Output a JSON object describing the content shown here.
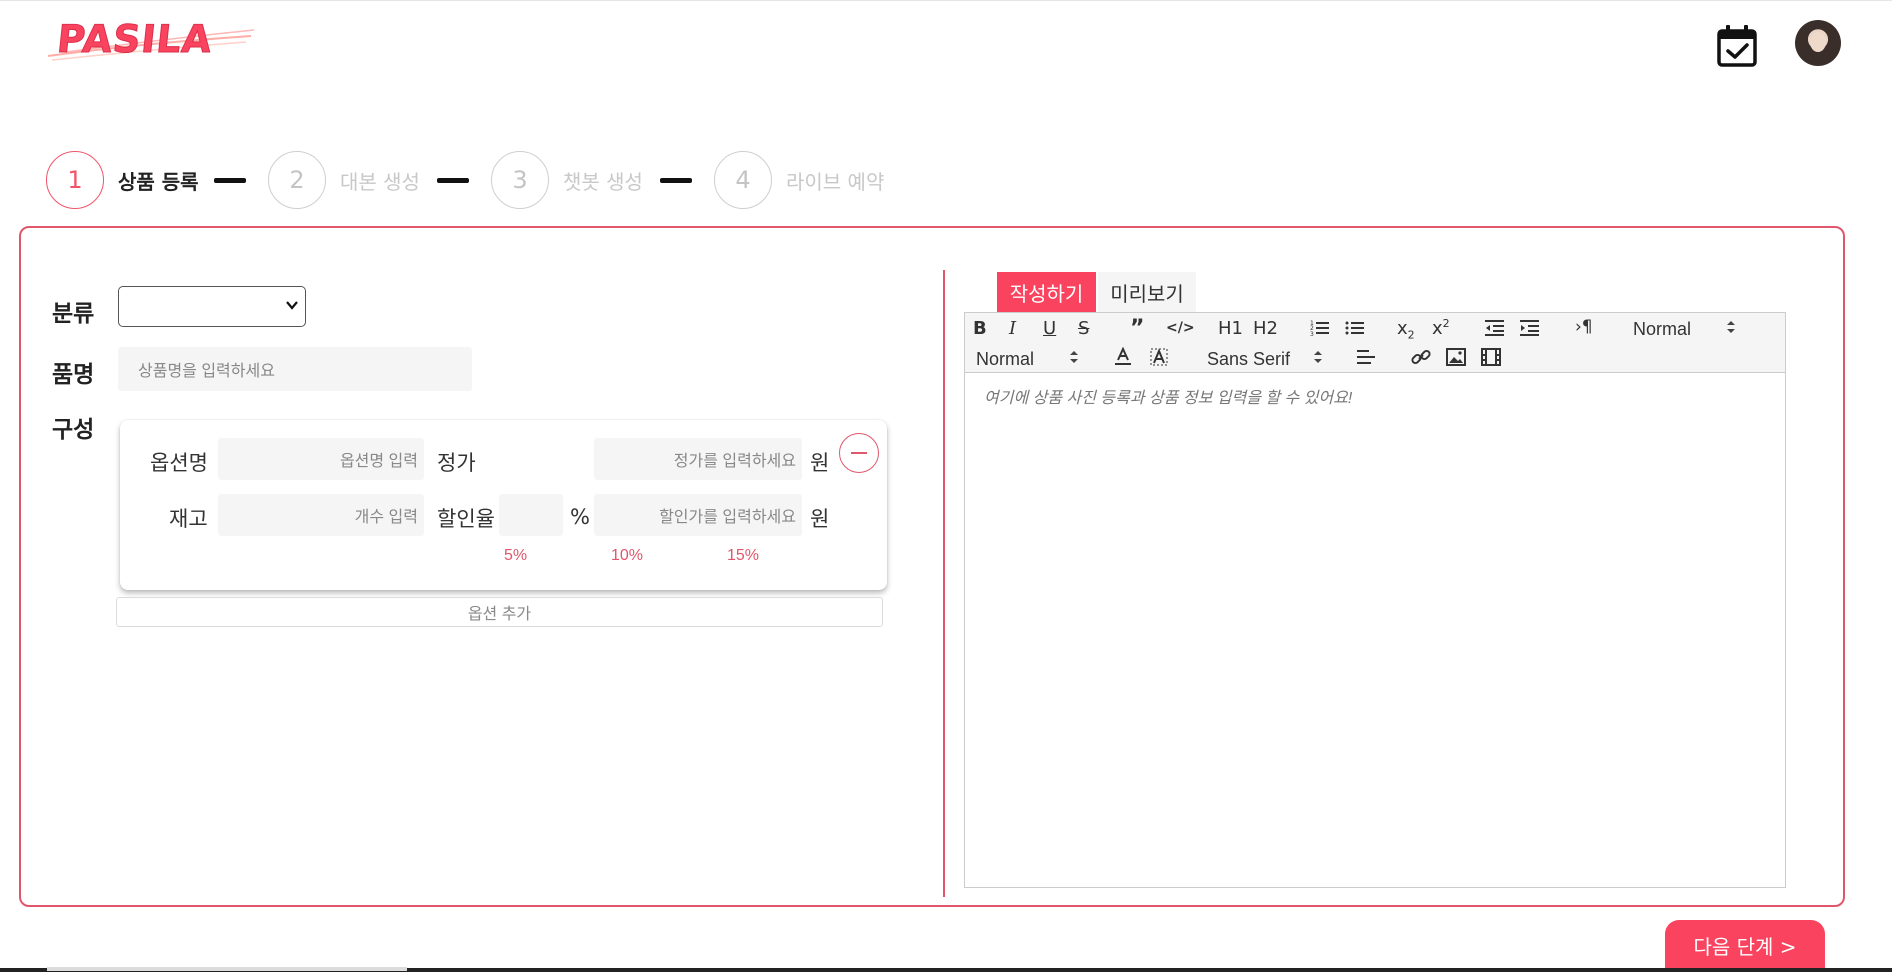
{
  "header": {
    "logo_text": "PASILA",
    "calendar_icon": "calendar-check-icon",
    "avatar": "user-avatar"
  },
  "stepper": {
    "steps": [
      {
        "number": "1",
        "label": "상품 등록",
        "active": true
      },
      {
        "number": "2",
        "label": "대본 생성",
        "active": false
      },
      {
        "number": "3",
        "label": "챗봇 생성",
        "active": false
      },
      {
        "number": "4",
        "label": "라이브 예약",
        "active": false
      }
    ]
  },
  "form": {
    "category_label": "분류",
    "category_value": "",
    "name_label": "품명",
    "name_placeholder": "상품명을 입력하세요",
    "composition_label": "구성",
    "option": {
      "option_name_label": "옵션명",
      "option_name_placeholder": "옵션명 입력",
      "price_label": "정가",
      "price_placeholder": "정가를 입력하세요",
      "price_unit": "원",
      "stock_label": "재고",
      "stock_placeholder": "개수 입력",
      "discount_label": "할인율",
      "discount_unit": "%",
      "discount_price_placeholder": "할인가를 입력하세요",
      "discount_price_unit": "원",
      "presets": [
        "5%",
        "10%",
        "15%"
      ]
    },
    "add_option_label": "옵션 추가"
  },
  "editor": {
    "tabs": [
      {
        "label": "작성하기",
        "active": true
      },
      {
        "label": "미리보기",
        "active": false
      }
    ],
    "toolbar": {
      "header_select": "Normal",
      "size_select": "Normal",
      "font_select": "Sans Serif",
      "h1": "H1",
      "h2": "H2"
    },
    "placeholder": "여기에 상품 사진 등록과 상품 정보 입력을 할 수 있어요!"
  },
  "actions": {
    "next_label": "다음 단계 >"
  },
  "colors": {
    "accent": "#f9435f",
    "border": "#e0576b"
  }
}
